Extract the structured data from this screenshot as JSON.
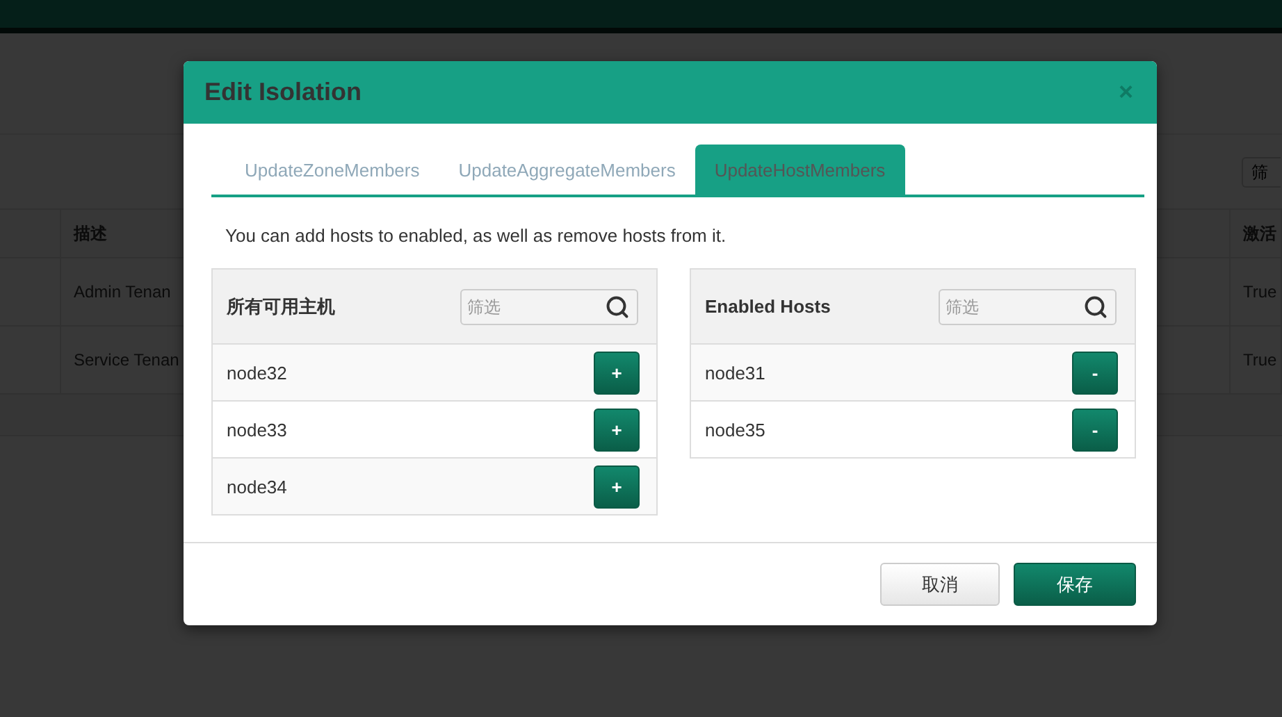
{
  "background": {
    "filter_placeholder": "筛",
    "columns": [
      "描述",
      "激活"
    ],
    "rows": [
      [
        "Admin Tenan",
        "True"
      ],
      [
        "Service Tenan",
        "True"
      ]
    ]
  },
  "dialog": {
    "title": "Edit Isolation",
    "close": "×",
    "tabs": [
      {
        "label": "UpdateZoneMembers",
        "selected": false
      },
      {
        "label": "UpdateAggregateMembers",
        "selected": false
      },
      {
        "label": "UpdateHostMembers",
        "selected": true
      }
    ],
    "description": "You can add hosts to enabled, as well as remove hosts from it.",
    "panels": [
      {
        "title": "所有可用主机",
        "filter_placeholder": "筛选",
        "hosts": [
          {
            "name": "node32",
            "action": "+"
          },
          {
            "name": "node33",
            "action": "+"
          },
          {
            "name": "node34",
            "action": "+"
          }
        ]
      },
      {
        "title": "Enabled Hosts",
        "filter_placeholder": "筛选",
        "hosts": [
          {
            "name": "node31",
            "action": "-"
          },
          {
            "name": "node35",
            "action": "-"
          }
        ]
      }
    ],
    "buttons": [
      {
        "label": "取消",
        "kind": "secondary"
      },
      {
        "label": "保存",
        "kind": "primary"
      }
    ]
  }
}
